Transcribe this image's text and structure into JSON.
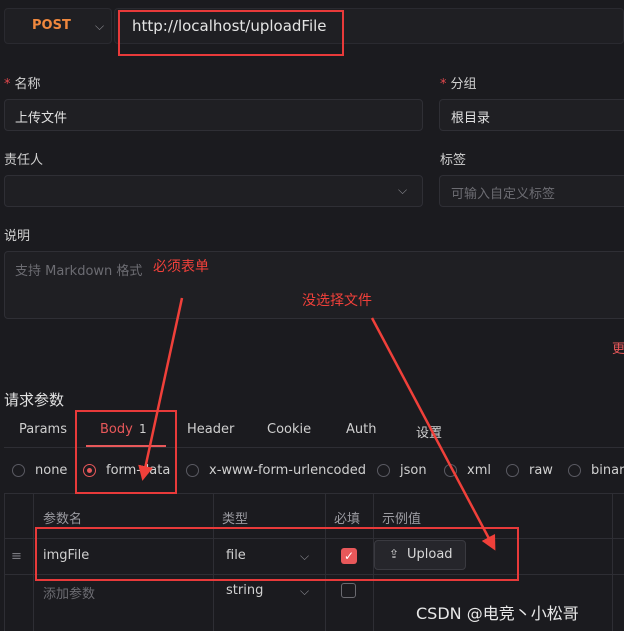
{
  "request": {
    "method": "POST",
    "url": "http://localhost/uploadFile"
  },
  "form": {
    "name_label": "名称",
    "name_value": "上传文件",
    "group_label": "分组",
    "group_value": "根目录",
    "owner_label": "责任人",
    "owner_value": "",
    "tags_label": "标签",
    "tags_placeholder": "可输入自定义标签",
    "desc_label": "说明",
    "desc_placeholder": "支持 Markdown 格式",
    "more_link": "更"
  },
  "params": {
    "section_title": "请求参数",
    "tabs": [
      {
        "label": "Params"
      },
      {
        "label": "Body",
        "badge": "1"
      },
      {
        "label": "Header"
      },
      {
        "label": "Cookie"
      },
      {
        "label": "Auth"
      },
      {
        "label": "设置"
      }
    ],
    "body_types": [
      "none",
      "form-data",
      "x-www-form-urlencoded",
      "json",
      "xml",
      "raw",
      "binar"
    ],
    "selected_body_type": "form-data",
    "columns": [
      "参数名",
      "类型",
      "必填",
      "示例值"
    ],
    "rows": [
      {
        "name": "imgFile",
        "type": "file",
        "required": true,
        "example_button": "Upload"
      },
      {
        "name_placeholder": "添加参数",
        "type": "string",
        "required": false
      }
    ]
  },
  "annotations": {
    "must_form": "必须表单",
    "no_file": "没选择文件"
  },
  "watermark": "CSDN @电竞丶小松哥",
  "colors": {
    "accent": "#e8585a",
    "annotation_red": "#f0403a",
    "method": "#f0883e"
  }
}
